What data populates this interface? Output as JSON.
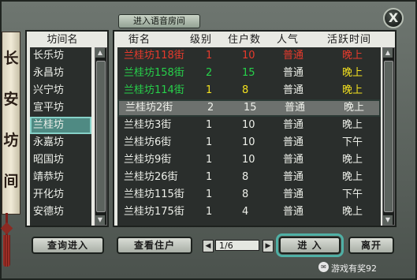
{
  "window": {
    "title_button": "进入语音房间",
    "close_label": "X"
  },
  "plaque": {
    "chars": [
      "长",
      "安",
      "坊",
      "间"
    ]
  },
  "districts": {
    "header": "坊间名",
    "items": [
      "长乐坊",
      "永昌坊",
      "兴宁坊",
      "宣平坊",
      "兰桂坊",
      "永嘉坊",
      "昭国坊",
      "靖恭坊",
      "开化坊",
      "安德坊"
    ],
    "selected_index": 4
  },
  "streets": {
    "headers": {
      "name": "街名",
      "level": "级别",
      "households": "住户数",
      "popularity": "人气",
      "active_time": "活跃时间"
    },
    "rows": [
      {
        "name": "兰桂坊118街",
        "level": "1",
        "households": "10",
        "popularity": "普通",
        "active_time": "晚上",
        "style": "hidden-row"
      },
      {
        "name": "兰桂坊158街",
        "level": "2",
        "households": "15",
        "popularity": "普通",
        "active_time": "晚上",
        "style": "green"
      },
      {
        "name": "兰桂坊114街",
        "level": "1",
        "households": "8",
        "popularity": "普通",
        "active_time": "晚上",
        "style": "yellow"
      },
      {
        "name": "兰桂坊2街",
        "level": "2",
        "households": "15",
        "popularity": "普通",
        "active_time": "晚上",
        "style": "selected"
      },
      {
        "name": "兰桂坊3街",
        "level": "1",
        "households": "10",
        "popularity": "普通",
        "active_time": "晚上",
        "style": ""
      },
      {
        "name": "兰桂坊6街",
        "level": "1",
        "households": "10",
        "popularity": "普通",
        "active_time": "下午",
        "style": ""
      },
      {
        "name": "兰桂坊9街",
        "level": "1",
        "households": "10",
        "popularity": "普通",
        "active_time": "晚上",
        "style": ""
      },
      {
        "name": "兰桂坊26街",
        "level": "1",
        "households": "8",
        "popularity": "普通",
        "active_time": "晚上",
        "style": ""
      },
      {
        "name": "兰桂坊115街",
        "level": "1",
        "households": "8",
        "popularity": "普通",
        "active_time": "下午",
        "style": ""
      },
      {
        "name": "兰桂坊175街",
        "level": "1",
        "households": "4",
        "popularity": "普通",
        "active_time": "晚上",
        "style": ""
      }
    ]
  },
  "buttons": {
    "query_enter": "查询进入",
    "view_residents": "查看住户",
    "page": "1/6",
    "enter": "进 入",
    "leave": "离开"
  },
  "watermark": "游戏有奖92",
  "colors": {
    "selected_district": "#4f8a83",
    "hidden_row": "#e83a2c",
    "green_row": "#27d14a",
    "yellow_row": "#f3e11f"
  }
}
